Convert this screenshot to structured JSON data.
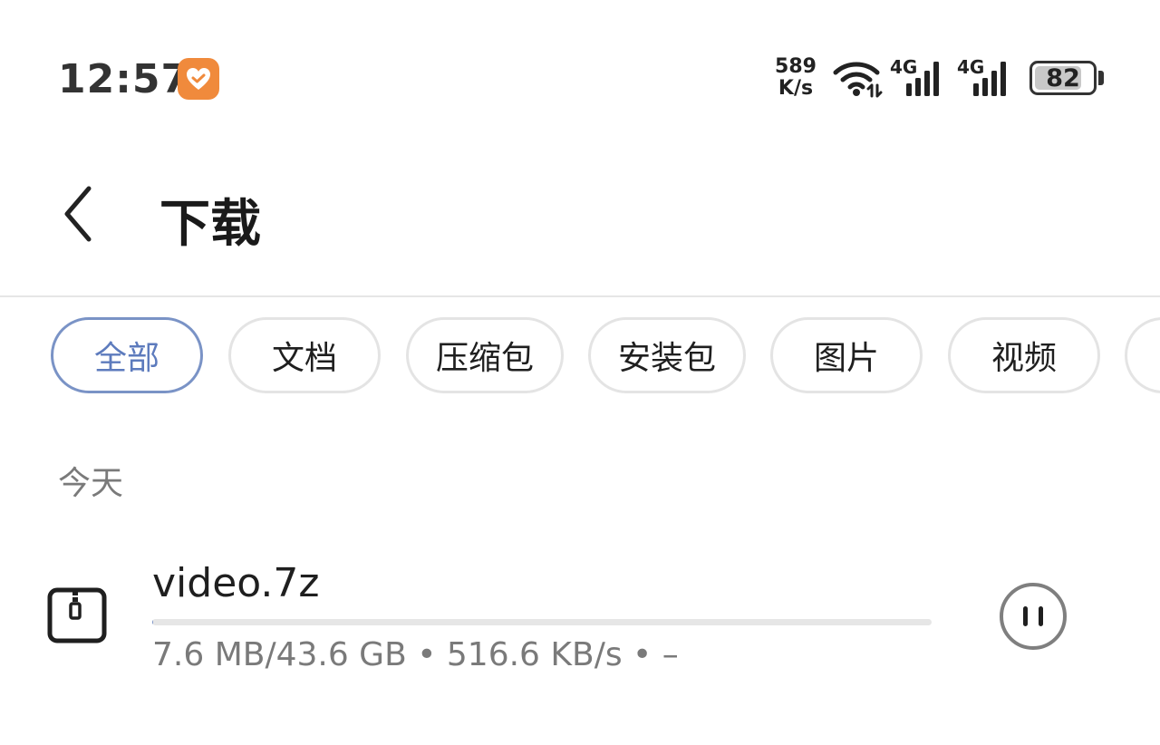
{
  "status_bar": {
    "time": "12:57",
    "app_badge_icon": "heart-badge-icon",
    "net_speed_value": "589",
    "net_speed_unit": "K/s",
    "sim1_label": "4G",
    "sim2_label": "4G",
    "battery_level": "82",
    "battery_fraction": 0.82
  },
  "header": {
    "title": "下载",
    "back_icon": "chevron-left-icon"
  },
  "tabs": [
    {
      "label": "全部",
      "active": true
    },
    {
      "label": "文档",
      "active": false
    },
    {
      "label": "压缩包",
      "active": false
    },
    {
      "label": "安装包",
      "active": false
    },
    {
      "label": "图片",
      "active": false
    },
    {
      "label": "视频",
      "active": false
    },
    {
      "label": "",
      "active": false
    }
  ],
  "section": {
    "label": "今天"
  },
  "download": {
    "file_name": "video.7z",
    "file_icon": "archive-file-icon",
    "progress_fraction": 0.0002,
    "meta": "7.6 MB/43.6 GB • 516.6 KB/s • –",
    "action_icon": "pause-icon"
  },
  "colors": {
    "accent": "#7a93c6",
    "accent_text": "#5d7bbd",
    "badge": "#f08a3c",
    "secondary_text": "#7a7a7a"
  }
}
